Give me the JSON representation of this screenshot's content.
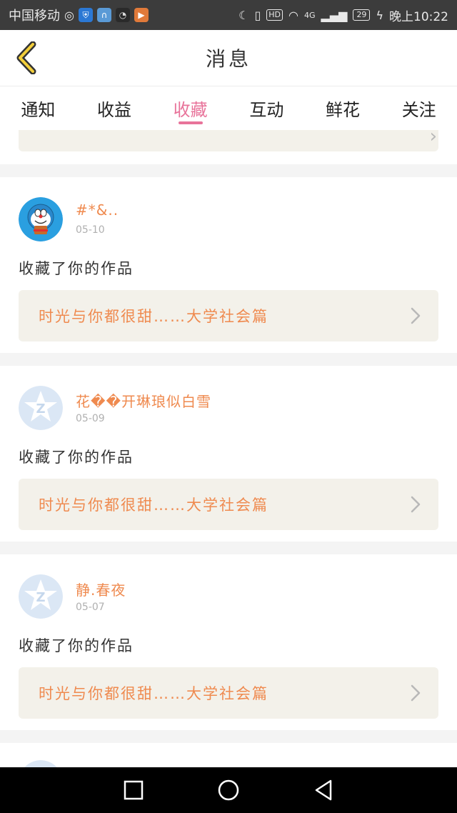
{
  "status_bar": {
    "carrier": "中国移动",
    "network": "4G",
    "battery": "29",
    "time": "晚上10:22",
    "hd_label": "HD"
  },
  "header": {
    "title": "消息",
    "back_icon": "back-chevron-icon"
  },
  "tabs": [
    {
      "label": "通知",
      "active": false
    },
    {
      "label": "收益",
      "active": false
    },
    {
      "label": "收藏",
      "active": true
    },
    {
      "label": "互动",
      "active": false
    },
    {
      "label": "鲜花",
      "active": false
    },
    {
      "label": "关注",
      "active": false
    }
  ],
  "feed": {
    "items": [
      {
        "username": "#*&..",
        "date": "05-10",
        "action": "收藏了你的作品",
        "work_title": "时光与你都很甜……大学社会篇",
        "avatar": "doraemon-avatar"
      },
      {
        "username": "花��开琳琅似白雪",
        "date": "05-09",
        "action": "收藏了你的作品",
        "work_title": "时光与你都很甜……大学社会篇",
        "avatar": "default-avatar"
      },
      {
        "username": "静.春夜",
        "date": "05-07",
        "action": "收藏了你的作品",
        "work_title": "时光与你都很甜……大学社会篇",
        "avatar": "default-avatar"
      }
    ]
  },
  "colors": {
    "accent_pink": "#e8739a",
    "accent_orange": "#ef8a4f",
    "link_bg": "#f3f1ea"
  }
}
